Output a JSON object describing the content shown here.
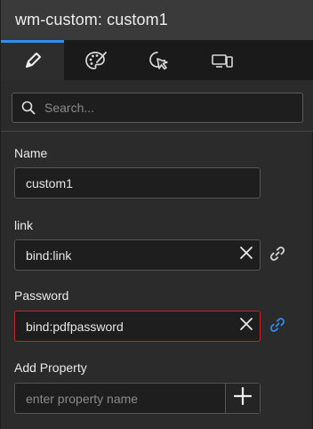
{
  "header": {
    "title": "wm-custom: custom1"
  },
  "tabs": [
    {
      "icon": "pencil-icon",
      "active": true
    },
    {
      "icon": "palette-icon",
      "active": false
    },
    {
      "icon": "cursor-click-icon",
      "active": false
    },
    {
      "icon": "devices-icon",
      "active": false
    }
  ],
  "search": {
    "placeholder": "Search...",
    "value": ""
  },
  "properties": {
    "name": {
      "label": "Name",
      "value": "custom1"
    },
    "link": {
      "label": "link",
      "value": "bind:link"
    },
    "password": {
      "label": "Password",
      "value": "bind:pdfpassword"
    }
  },
  "add_property": {
    "label": "Add Property",
    "placeholder": "enter property name"
  },
  "colors": {
    "accent": "#2f8ef0",
    "error_border": "#c0262e",
    "bound_link": "#2f8ef0",
    "unbound_link": "#d8d8d8"
  }
}
